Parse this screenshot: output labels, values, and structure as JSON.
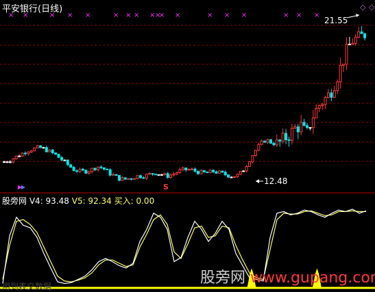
{
  "app": {
    "title": "平安银行(日线)"
  },
  "indicator": {
    "name": "股旁网",
    "v4": "V4: 93.48",
    "v5": "V5: 92.34",
    "buy": "买入: 0.00"
  },
  "annotations": {
    "high_price": "21.55",
    "low_price": "12.48",
    "sell_marker": "S"
  },
  "watermark": {
    "left_text": "用到表交数据",
    "brand": "股旁网",
    "domain": "www.gupang.com"
  },
  "icons": {
    "top_right": [
      "diamond-icon",
      "diamond-icon"
    ],
    "top_markers": "magenta-x-icon"
  },
  "colors": {
    "up": "#ff3a3a",
    "down": "#00e5e5",
    "flat": "#ffffff",
    "marker": "#ff33ff",
    "gridline": "#8b0000",
    "v4_line": "#ffffff",
    "v5_line": "#ffff66",
    "buy_signal": "#ffff00"
  },
  "chart_data": {
    "type": "candlestick",
    "x_markers_count": 15,
    "price_path": [
      13.5,
      13.6,
      13.8,
      14.0,
      14.2,
      14.3,
      14.4,
      14.3,
      14.1,
      13.9,
      13.6,
      13.3,
      13.0,
      12.9,
      12.9,
      13.0,
      13.2,
      13.1,
      12.8,
      12.6,
      12.4,
      12.4,
      12.5,
      12.6,
      12.6,
      12.7,
      12.8,
      12.7,
      12.6,
      12.7,
      12.9,
      13.0,
      13.0,
      12.9,
      12.8,
      12.8,
      12.9,
      12.8,
      12.7,
      12.6,
      12.6,
      12.9,
      13.5,
      14.1,
      14.6,
      14.9,
      14.7,
      14.6,
      14.9,
      15.2,
      15.6,
      15.8,
      15.2,
      16.3,
      17.0,
      17.4,
      17.8,
      18.6,
      19.6,
      20.6,
      21.2,
      21.3,
      21.55
    ],
    "v4_path": [
      3,
      62,
      85,
      75,
      72,
      60,
      40,
      22,
      5,
      3,
      4,
      8,
      12,
      20,
      30,
      34,
      30,
      25,
      22,
      28,
      55,
      70,
      90,
      85,
      70,
      30,
      35,
      60,
      80,
      70,
      55,
      65,
      80,
      70,
      40,
      25,
      10,
      8,
      6,
      60,
      90,
      92,
      88,
      90,
      94,
      92,
      88,
      85,
      90,
      94,
      92,
      95,
      90,
      93
    ],
    "v5_path": [
      8,
      50,
      80,
      82,
      76,
      66,
      48,
      30,
      12,
      6,
      5,
      7,
      10,
      16,
      26,
      32,
      32,
      28,
      24,
      26,
      48,
      64,
      82,
      88,
      76,
      42,
      34,
      52,
      72,
      74,
      60,
      62,
      74,
      72,
      50,
      32,
      16,
      10,
      8,
      45,
      82,
      90,
      89,
      89,
      92,
      93,
      90,
      87,
      88,
      92,
      92,
      93,
      92,
      92
    ],
    "buy_signal_positions": [
      0.685,
      0.865
    ]
  }
}
